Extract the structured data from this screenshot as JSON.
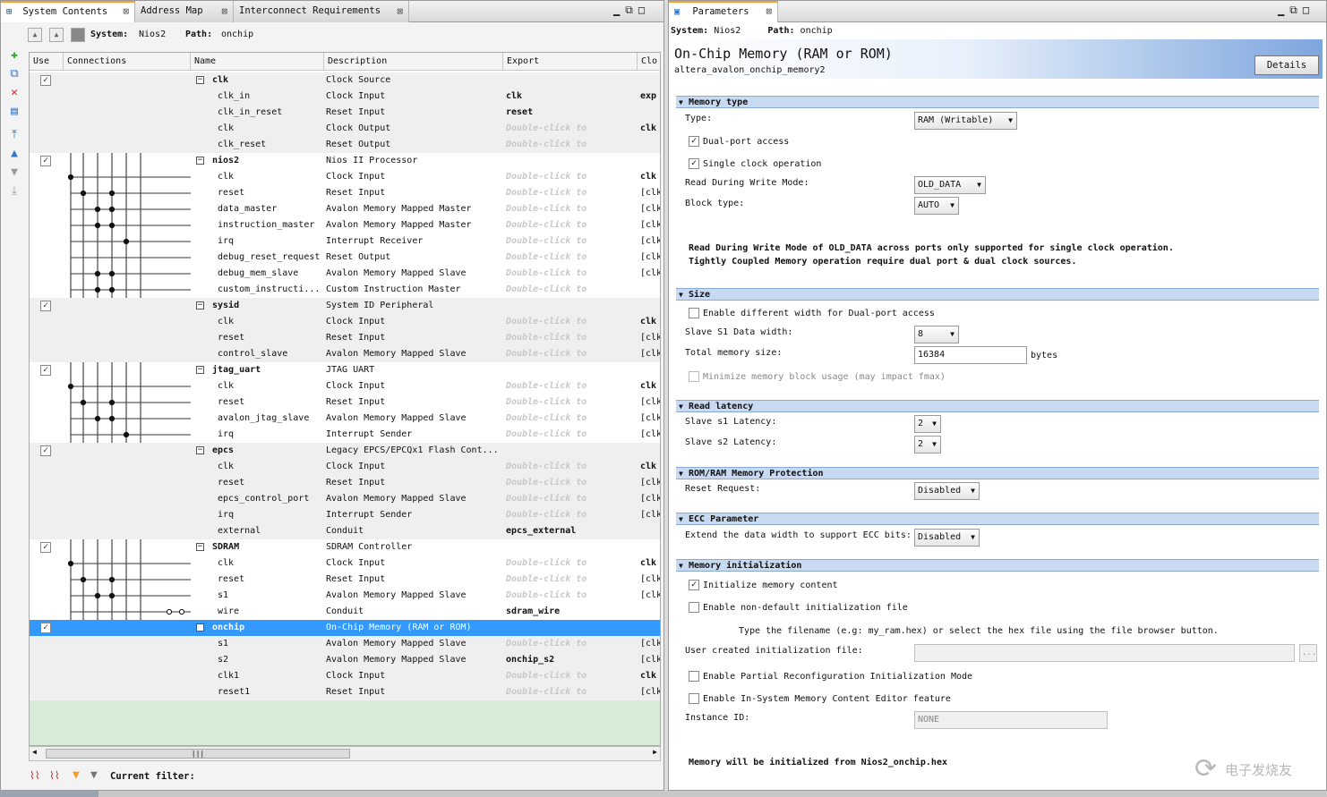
{
  "left_tabs": [
    {
      "label": "System Contents"
    },
    {
      "label": "Address Map"
    },
    {
      "label": "Interconnect Requirements"
    }
  ],
  "subbar": {
    "system_label": "System:",
    "system": "Nios2",
    "path_label": "Path:",
    "path": "onchip"
  },
  "columns": [
    "Use",
    "Connections",
    "Name",
    "Description",
    "Export",
    "Clo"
  ],
  "rows": [
    {
      "kind": "comp",
      "use": "✓",
      "name": "clk",
      "desc": "Clock Source",
      "export": "",
      "clk": ""
    },
    {
      "kind": "port",
      "name": "clk_in",
      "desc": "Clock Input",
      "export": "clk",
      "clk": "exp"
    },
    {
      "kind": "port",
      "name": "clk_in_reset",
      "desc": "Reset Input",
      "export": "reset",
      "clk": ""
    },
    {
      "kind": "port",
      "name": "clk",
      "desc": "Clock Output",
      "export": "Double-click to",
      "clk": "clk"
    },
    {
      "kind": "port",
      "name": "clk_reset",
      "desc": "Reset Output",
      "export": "Double-click to",
      "clk": ""
    },
    {
      "kind": "comp",
      "use": "✓",
      "name": "nios2",
      "desc": "Nios II Processor",
      "export": "",
      "clk": ""
    },
    {
      "kind": "port",
      "name": "clk",
      "desc": "Clock Input",
      "export": "Double-click to",
      "clk": "clk"
    },
    {
      "kind": "port",
      "name": "reset",
      "desc": "Reset Input",
      "export": "Double-click to",
      "clk": "[clk"
    },
    {
      "kind": "port",
      "name": "data_master",
      "desc": "Avalon Memory Mapped Master",
      "export": "Double-click to",
      "clk": "[clk"
    },
    {
      "kind": "port",
      "name": "instruction_master",
      "desc": "Avalon Memory Mapped Master",
      "export": "Double-click to",
      "clk": "[clk"
    },
    {
      "kind": "port",
      "name": "irq",
      "desc": "Interrupt Receiver",
      "export": "Double-click to",
      "clk": "[clk"
    },
    {
      "kind": "port",
      "name": "debug_reset_request",
      "desc": "Reset Output",
      "export": "Double-click to",
      "clk": "[clk"
    },
    {
      "kind": "port",
      "name": "debug_mem_slave",
      "desc": "Avalon Memory Mapped Slave",
      "export": "Double-click to",
      "clk": "[clk"
    },
    {
      "kind": "port",
      "name": "custom_instructi...",
      "desc": "Custom Instruction Master",
      "export": "Double-click to",
      "clk": ""
    },
    {
      "kind": "comp",
      "use": "✓",
      "name": "sysid",
      "desc": "System ID Peripheral",
      "export": "",
      "clk": ""
    },
    {
      "kind": "port",
      "name": "clk",
      "desc": "Clock Input",
      "export": "Double-click to",
      "clk": "clk"
    },
    {
      "kind": "port",
      "name": "reset",
      "desc": "Reset Input",
      "export": "Double-click to",
      "clk": "[clk"
    },
    {
      "kind": "port",
      "name": "control_slave",
      "desc": "Avalon Memory Mapped Slave",
      "export": "Double-click to",
      "clk": "[clk"
    },
    {
      "kind": "comp",
      "use": "✓",
      "name": "jtag_uart",
      "desc": "JTAG UART",
      "export": "",
      "clk": ""
    },
    {
      "kind": "port",
      "name": "clk",
      "desc": "Clock Input",
      "export": "Double-click to",
      "clk": "clk"
    },
    {
      "kind": "port",
      "name": "reset",
      "desc": "Reset Input",
      "export": "Double-click to",
      "clk": "[clk"
    },
    {
      "kind": "port",
      "name": "avalon_jtag_slave",
      "desc": "Avalon Memory Mapped Slave",
      "export": "Double-click to",
      "clk": "[clk"
    },
    {
      "kind": "port",
      "name": "irq",
      "desc": "Interrupt Sender",
      "export": "Double-click to",
      "clk": "[clk"
    },
    {
      "kind": "comp",
      "use": "✓",
      "name": "epcs",
      "desc": "Legacy EPCS/EPCQx1 Flash Cont...",
      "export": "",
      "clk": ""
    },
    {
      "kind": "port",
      "name": "clk",
      "desc": "Clock Input",
      "export": "Double-click to",
      "clk": "clk"
    },
    {
      "kind": "port",
      "name": "reset",
      "desc": "Reset Input",
      "export": "Double-click to",
      "clk": "[clk"
    },
    {
      "kind": "port",
      "name": "epcs_control_port",
      "desc": "Avalon Memory Mapped Slave",
      "export": "Double-click to",
      "clk": "[clk"
    },
    {
      "kind": "port",
      "name": "irq",
      "desc": "Interrupt Sender",
      "export": "Double-click to",
      "clk": "[clk"
    },
    {
      "kind": "port",
      "name": "external",
      "desc": "Conduit",
      "export": "epcs_external",
      "clk": ""
    },
    {
      "kind": "comp",
      "use": "✓",
      "name": "SDRAM",
      "desc": "SDRAM Controller",
      "export": "",
      "clk": ""
    },
    {
      "kind": "port",
      "name": "clk",
      "desc": "Clock Input",
      "export": "Double-click to",
      "clk": "clk"
    },
    {
      "kind": "port",
      "name": "reset",
      "desc": "Reset Input",
      "export": "Double-click to",
      "clk": "[clk"
    },
    {
      "kind": "port",
      "name": "s1",
      "desc": "Avalon Memory Mapped Slave",
      "export": "Double-click to",
      "clk": "[clk"
    },
    {
      "kind": "port",
      "name": "wire",
      "desc": "Conduit",
      "export": "sdram_wire",
      "clk": ""
    },
    {
      "kind": "comp",
      "use": "✓",
      "name": "onchip",
      "desc": "On-Chip Memory (RAM or ROM)",
      "export": "",
      "clk": "",
      "selected": true
    },
    {
      "kind": "port",
      "name": "s1",
      "desc": "Avalon Memory Mapped Slave",
      "export": "Double-click to",
      "clk": "[clk"
    },
    {
      "kind": "port",
      "name": "s2",
      "desc": "Avalon Memory Mapped Slave",
      "export": "onchip_s2",
      "clk": "[clk"
    },
    {
      "kind": "port",
      "name": "clk1",
      "desc": "Clock Input",
      "export": "Double-click to",
      "clk": "clk"
    },
    {
      "kind": "port",
      "name": "reset1",
      "desc": "Reset Input",
      "export": "Double-click to",
      "clk": "[clk"
    }
  ],
  "filter": {
    "label": "Current filter:"
  },
  "right_tab": {
    "label": "Parameters"
  },
  "right_path": {
    "system_label": "System:",
    "system": "Nios2",
    "path_label": "Path:",
    "path": "onchip"
  },
  "header": {
    "title": "On-Chip Memory (RAM or ROM)",
    "subtitle": "altera_avalon_onchip_memory2",
    "details_button": "Details"
  },
  "memory_type": {
    "section": "Memory type",
    "type_label": "Type:",
    "type_value": "RAM (Writable)",
    "dual_port_label": "Dual-port access",
    "dual_port": true,
    "single_clock_label": "Single clock operation",
    "single_clock": true,
    "rdw_label": "Read During Write Mode:",
    "rdw_value": "OLD_DATA",
    "block_label": "Block type:",
    "block_value": "AUTO",
    "note1": "Read During Write Mode of OLD_DATA across ports only supported for single clock operation.",
    "note2": "Tightly Coupled Memory operation require dual port & dual clock sources."
  },
  "size": {
    "section": "Size",
    "diff_width_label": "Enable different width for Dual-port access",
    "s1_width_label": "Slave S1 Data width:",
    "s1_width_value": "8",
    "total_label": "Total memory size:",
    "total_value": "16384",
    "total_unit": "bytes",
    "minimize_label": "Minimize memory block usage (may impact fmax)"
  },
  "latency": {
    "section": "Read latency",
    "s1_label": "Slave s1 Latency:",
    "s1_value": "2",
    "s2_label": "Slave s2 Latency:",
    "s2_value": "2"
  },
  "protection": {
    "section": "ROM/RAM Memory Protection",
    "reset_label": "Reset Request:",
    "reset_value": "Disabled"
  },
  "ecc": {
    "section": "ECC Parameter",
    "label": "Extend the data width to support ECC bits:",
    "value": "Disabled"
  },
  "init": {
    "section": "Memory initialization",
    "init_content_label": "Initialize memory content",
    "init_content": true,
    "non_default_label": "Enable non-default initialization file",
    "hint": "Type the filename (e.g: my_ram.hex) or select the hex file using the file browser button.",
    "user_file_label": "User created initialization file:",
    "user_file_value": "",
    "browse": "...",
    "partial_label": "Enable Partial Reconfiguration Initialization Mode",
    "insystem_label": "Enable In-System Memory Content Editor feature",
    "instance_label": "Instance ID:",
    "instance_value": "NONE",
    "final_note": "Memory will be initialized from Nios2_onchip.hex"
  },
  "watermark": "电子发烧友",
  "icons": [
    "add-icon",
    "remove-icon",
    "move-up-icon",
    "move-down-icon",
    "close-tab-icon",
    "filter-icon"
  ]
}
